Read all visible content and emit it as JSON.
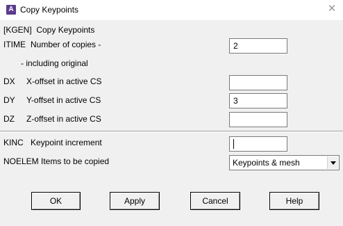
{
  "window": {
    "title": "Copy Keypoints",
    "app_icon_letter": "A"
  },
  "header": {
    "command": "[KGEN]  Copy Keypoints"
  },
  "itime": {
    "code": "ITIME",
    "label": "Number of copies -",
    "sublabel": "- including original",
    "value": "2"
  },
  "dx": {
    "code": "DX",
    "label": "X-offset in active CS",
    "value": ""
  },
  "dy": {
    "code": "DY",
    "label": "Y-offset in active CS",
    "value": "3"
  },
  "dz": {
    "code": "DZ",
    "label": "Z-offset in active CS",
    "value": ""
  },
  "kinc": {
    "code": "KINC",
    "label": "Keypoint increment",
    "value": ""
  },
  "noelem": {
    "code": "NOELEM",
    "label": "Items to be copied",
    "selected": "Keypoints & mesh"
  },
  "buttons": {
    "ok": "OK",
    "apply": "Apply",
    "cancel": "Cancel",
    "help": "Help"
  }
}
